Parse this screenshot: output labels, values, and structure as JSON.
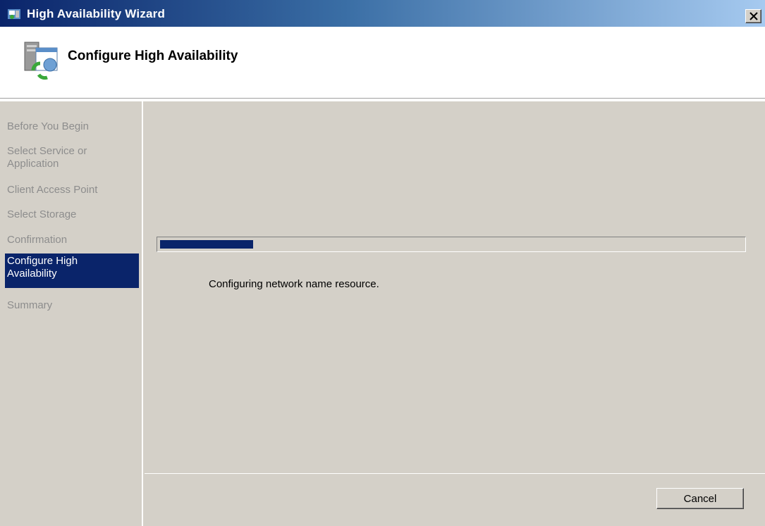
{
  "window": {
    "title": "High Availability Wizard",
    "close_label": "×"
  },
  "header": {
    "title": "Configure High Availability",
    "icon": "wizard-server-icon"
  },
  "sidebar": {
    "items": [
      {
        "label": "Before You Begin",
        "active": false
      },
      {
        "label": "Select Service or Application",
        "active": false
      },
      {
        "label": "Client Access Point",
        "active": false
      },
      {
        "label": "Select Storage",
        "active": false
      },
      {
        "label": "Confirmation",
        "active": false
      },
      {
        "label": "Configure High Availability",
        "active": true
      },
      {
        "label": "Summary",
        "active": false
      }
    ]
  },
  "main": {
    "progress_fraction": 0.16,
    "status": "Configuring network name resource."
  },
  "footer": {
    "cancel_label": "Cancel"
  },
  "colors": {
    "accent": "#0a246a",
    "face": "#d4d0c8",
    "disabled_text": "#8d8d8d"
  }
}
